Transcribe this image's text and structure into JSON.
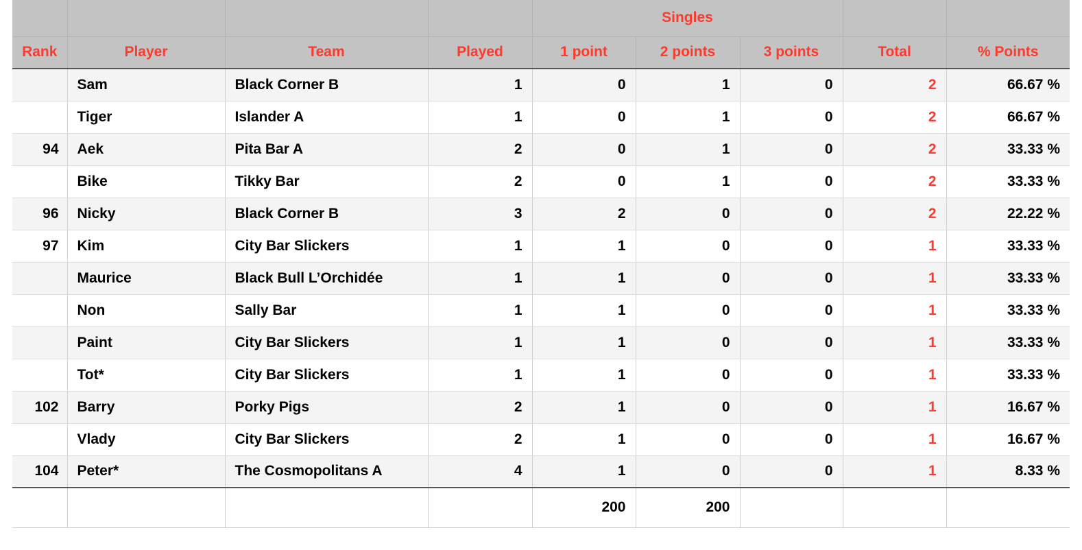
{
  "colors": {
    "accent_red": "#FC3A2D",
    "header_bg": "#C3C3C3",
    "row_alt_bg": "#F4F4F4",
    "row_bg": "#FFFFFF",
    "text": "#000000",
    "rule": "#575757"
  },
  "table": {
    "group_headers": {
      "rank": "",
      "player": "",
      "team": "",
      "played": "",
      "singles": "Singles",
      "total": "",
      "pct": ""
    },
    "columns": [
      {
        "key": "rank",
        "label": "Rank",
        "align": "right"
      },
      {
        "key": "player",
        "label": "Player",
        "align": "left"
      },
      {
        "key": "team",
        "label": "Team",
        "align": "left"
      },
      {
        "key": "played",
        "label": "Played",
        "align": "right"
      },
      {
        "key": "p1",
        "label": "1 point",
        "align": "right"
      },
      {
        "key": "p2",
        "label": "2 points",
        "align": "right"
      },
      {
        "key": "p3",
        "label": "3 points",
        "align": "right"
      },
      {
        "key": "total",
        "label": "Total",
        "align": "right"
      },
      {
        "key": "pct",
        "label": "% Points",
        "align": "right"
      }
    ],
    "rows": [
      {
        "rank": "",
        "player": "Sam",
        "team": "Black Corner B",
        "played": "1",
        "p1": "0",
        "p2": "1",
        "p3": "0",
        "total": "2",
        "pct": "66.67 %"
      },
      {
        "rank": "",
        "player": "Tiger",
        "team": "Islander A",
        "played": "1",
        "p1": "0",
        "p2": "1",
        "p3": "0",
        "total": "2",
        "pct": "66.67 %"
      },
      {
        "rank": "94",
        "player": "Aek",
        "team": "Pita Bar A",
        "played": "2",
        "p1": "0",
        "p2": "1",
        "p3": "0",
        "total": "2",
        "pct": "33.33 %"
      },
      {
        "rank": "",
        "player": "Bike",
        "team": "Tikky Bar",
        "played": "2",
        "p1": "0",
        "p2": "1",
        "p3": "0",
        "total": "2",
        "pct": "33.33 %"
      },
      {
        "rank": "96",
        "player": "Nicky",
        "team": "Black Corner B",
        "played": "3",
        "p1": "2",
        "p2": "0",
        "p3": "0",
        "total": "2",
        "pct": "22.22 %"
      },
      {
        "rank": "97",
        "player": "Kim",
        "team": "City Bar Slickers",
        "played": "1",
        "p1": "1",
        "p2": "0",
        "p3": "0",
        "total": "1",
        "pct": "33.33 %"
      },
      {
        "rank": "",
        "player": "Maurice",
        "team": "Black Bull L’Orchidée",
        "played": "1",
        "p1": "1",
        "p2": "0",
        "p3": "0",
        "total": "1",
        "pct": "33.33 %"
      },
      {
        "rank": "",
        "player": "Non",
        "team": "Sally Bar",
        "played": "1",
        "p1": "1",
        "p2": "0",
        "p3": "0",
        "total": "1",
        "pct": "33.33 %"
      },
      {
        "rank": "",
        "player": "Paint",
        "team": "City Bar Slickers",
        "played": "1",
        "p1": "1",
        "p2": "0",
        "p3": "0",
        "total": "1",
        "pct": "33.33 %"
      },
      {
        "rank": "",
        "player": "Tot*",
        "team": "City Bar Slickers",
        "played": "1",
        "p1": "1",
        "p2": "0",
        "p3": "0",
        "total": "1",
        "pct": "33.33 %"
      },
      {
        "rank": "102",
        "player": "Barry",
        "team": "Porky Pigs",
        "played": "2",
        "p1": "1",
        "p2": "0",
        "p3": "0",
        "total": "1",
        "pct": "16.67 %"
      },
      {
        "rank": "",
        "player": "Vlady",
        "team": "City Bar Slickers",
        "played": "2",
        "p1": "1",
        "p2": "0",
        "p3": "0",
        "total": "1",
        "pct": "16.67 %"
      },
      {
        "rank": "104",
        "player": "Peter*",
        "team": "The Cosmopolitans A",
        "played": "4",
        "p1": "1",
        "p2": "0",
        "p3": "0",
        "total": "1",
        "pct": "8.33 %"
      }
    ],
    "footer": {
      "rank": "",
      "player": "",
      "team": "",
      "played": "",
      "p1": "200",
      "p2": "200",
      "p3": "",
      "total": "",
      "pct": ""
    }
  }
}
